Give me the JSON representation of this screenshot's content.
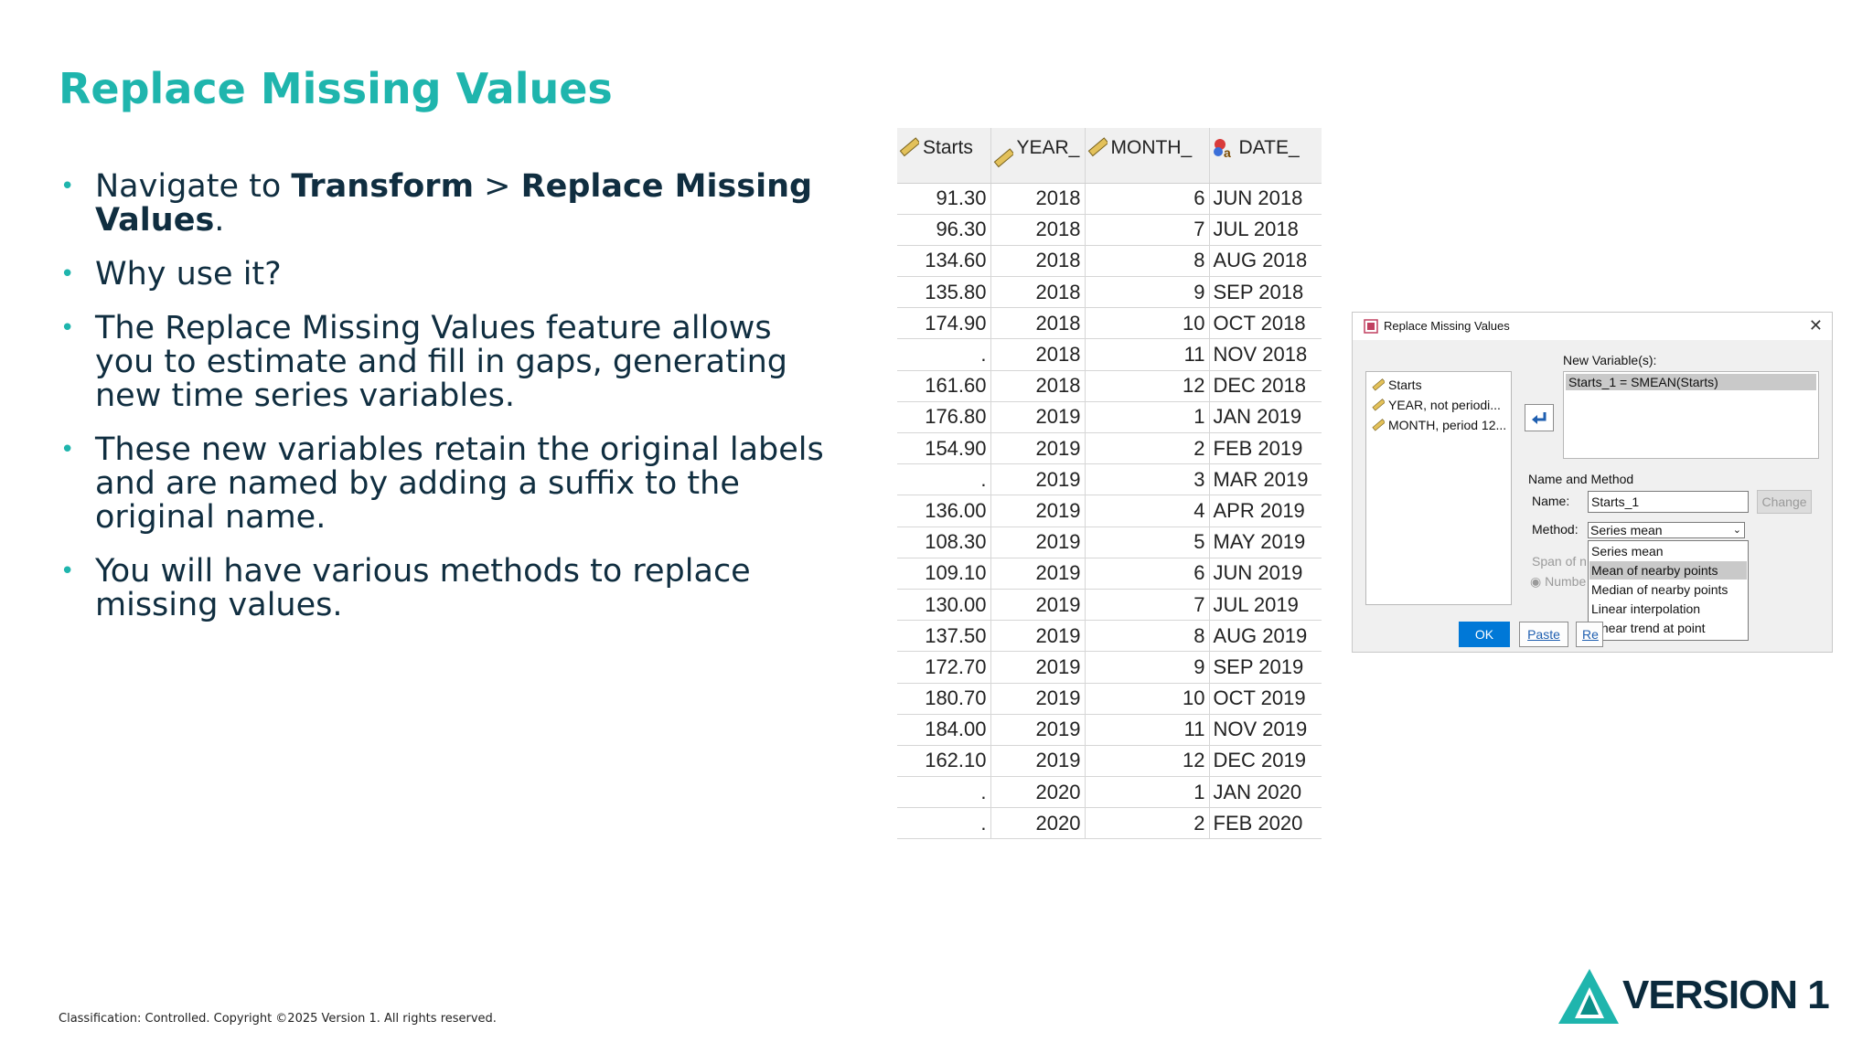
{
  "slide": {
    "title": "Replace Missing Values",
    "bullets": {
      "b1": {
        "pre": "Navigate to ",
        "b1": "Transform",
        "mid": " > ",
        "b2": "Replace Missing Values",
        "post": "."
      },
      "b2": "Why use it?",
      "b3": "The Replace Missing Values feature allows you to estimate and fill in gaps, generating new time series variables.",
      "b4": "These new variables retain the original labels and are named by adding a suffix to the original name.",
      "b5": "You will have various methods to replace missing values."
    },
    "footer": "Classification: Controlled. Copyright ©2025 Version 1. All rights reserved.",
    "logo_text": "VERSION 1"
  },
  "sheet": {
    "headers": {
      "starts": "Starts",
      "year": "YEAR_",
      "month": "MONTH_",
      "date": "DATE_"
    },
    "rows": [
      [
        "91.30",
        "2018",
        "6",
        "JUN 2018"
      ],
      [
        "96.30",
        "2018",
        "7",
        "JUL 2018"
      ],
      [
        "134.60",
        "2018",
        "8",
        "AUG 2018"
      ],
      [
        "135.80",
        "2018",
        "9",
        "SEP 2018"
      ],
      [
        "174.90",
        "2018",
        "10",
        "OCT 2018"
      ],
      [
        ".",
        "2018",
        "11",
        "NOV 2018"
      ],
      [
        "161.60",
        "2018",
        "12",
        "DEC 2018"
      ],
      [
        "176.80",
        "2019",
        "1",
        "JAN 2019"
      ],
      [
        "154.90",
        "2019",
        "2",
        "FEB 2019"
      ],
      [
        ".",
        "2019",
        "3",
        "MAR 2019"
      ],
      [
        "136.00",
        "2019",
        "4",
        "APR 2019"
      ],
      [
        "108.30",
        "2019",
        "5",
        "MAY 2019"
      ],
      [
        "109.10",
        "2019",
        "6",
        "JUN 2019"
      ],
      [
        "130.00",
        "2019",
        "7",
        "JUL 2019"
      ],
      [
        "137.50",
        "2019",
        "8",
        "AUG 2019"
      ],
      [
        "172.70",
        "2019",
        "9",
        "SEP 2019"
      ],
      [
        "180.70",
        "2019",
        "10",
        "OCT 2019"
      ],
      [
        "184.00",
        "2019",
        "11",
        "NOV 2019"
      ],
      [
        "162.10",
        "2019",
        "12",
        "DEC 2019"
      ],
      [
        ".",
        "2020",
        "1",
        "JAN 2020"
      ],
      [
        ".",
        "2020",
        "2",
        "FEB 2020"
      ]
    ]
  },
  "dialog": {
    "title": "Replace Missing Values",
    "variables": [
      "Starts",
      "YEAR, not periodi...",
      "MONTH, period 12..."
    ],
    "new_variables_label": "New Variable(s):",
    "new_variable": "Starts_1 = SMEAN(Starts)",
    "name_method_label": "Name and Method",
    "name_label": "Name:",
    "name_value": "Starts_1",
    "change_button": "Change",
    "method_label": "Method:",
    "method_value": "Series mean",
    "span_label": "Span of n",
    "number_label": "Numbe",
    "method_options": [
      "Series mean",
      "Mean of nearby points",
      "Median of nearby points",
      "Linear interpolation",
      "Linear trend at point"
    ],
    "ok_button": "OK",
    "paste_button": "Paste",
    "reset_button": "Re"
  },
  "colors": {
    "accent": "#1fb5ad",
    "text": "#0b2a3c",
    "ok_blue": "#0078d7"
  },
  "icons": {
    "bullet": "bullet-dot",
    "scale": "ruler-icon",
    "nominal": "shapes-a-icon",
    "close": "close-icon",
    "arrow": "move-arrow-icon"
  }
}
